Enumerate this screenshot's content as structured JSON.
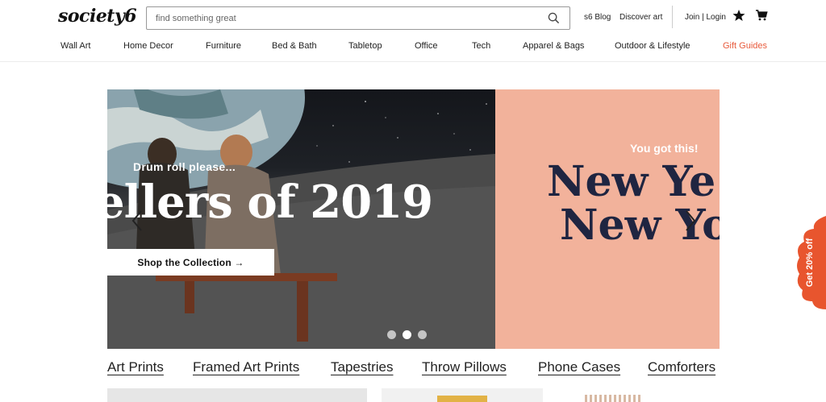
{
  "header": {
    "logo": "society6",
    "search": {
      "placeholder": "find something great",
      "value": ""
    },
    "links": {
      "blog": "s6 Blog",
      "discover": "Discover art",
      "join": "Join | Login"
    },
    "icons": [
      "search-icon",
      "star-icon",
      "cart-icon"
    ]
  },
  "nav": {
    "categories": [
      "Wall Art",
      "Home Decor",
      "Furniture",
      "Bed & Bath",
      "Tabletop",
      "Office",
      "Tech",
      "Apparel & Bags",
      "Outdoor & Lifestyle",
      "Gift Guides"
    ]
  },
  "hero": {
    "kicker": "Drum roll please...",
    "title": "ellers of 2019",
    "cta": "Shop the Collection →",
    "next_kicker": "You got this!",
    "next_title_1": "New Ye",
    "next_title_2": "New Yo",
    "slide_count": 3,
    "active_slide": 2
  },
  "promo": {
    "label": "Get 20% off"
  },
  "category_strip": [
    "Art Prints",
    "Framed Art Prints",
    "Tapestries",
    "Throw Pillows",
    "Phone Cases",
    "Comforters"
  ],
  "colors": {
    "accent": "#e85a3c",
    "hero_peach": "#f2b29b",
    "navy": "#1f2541",
    "promo": "#e8552e"
  }
}
